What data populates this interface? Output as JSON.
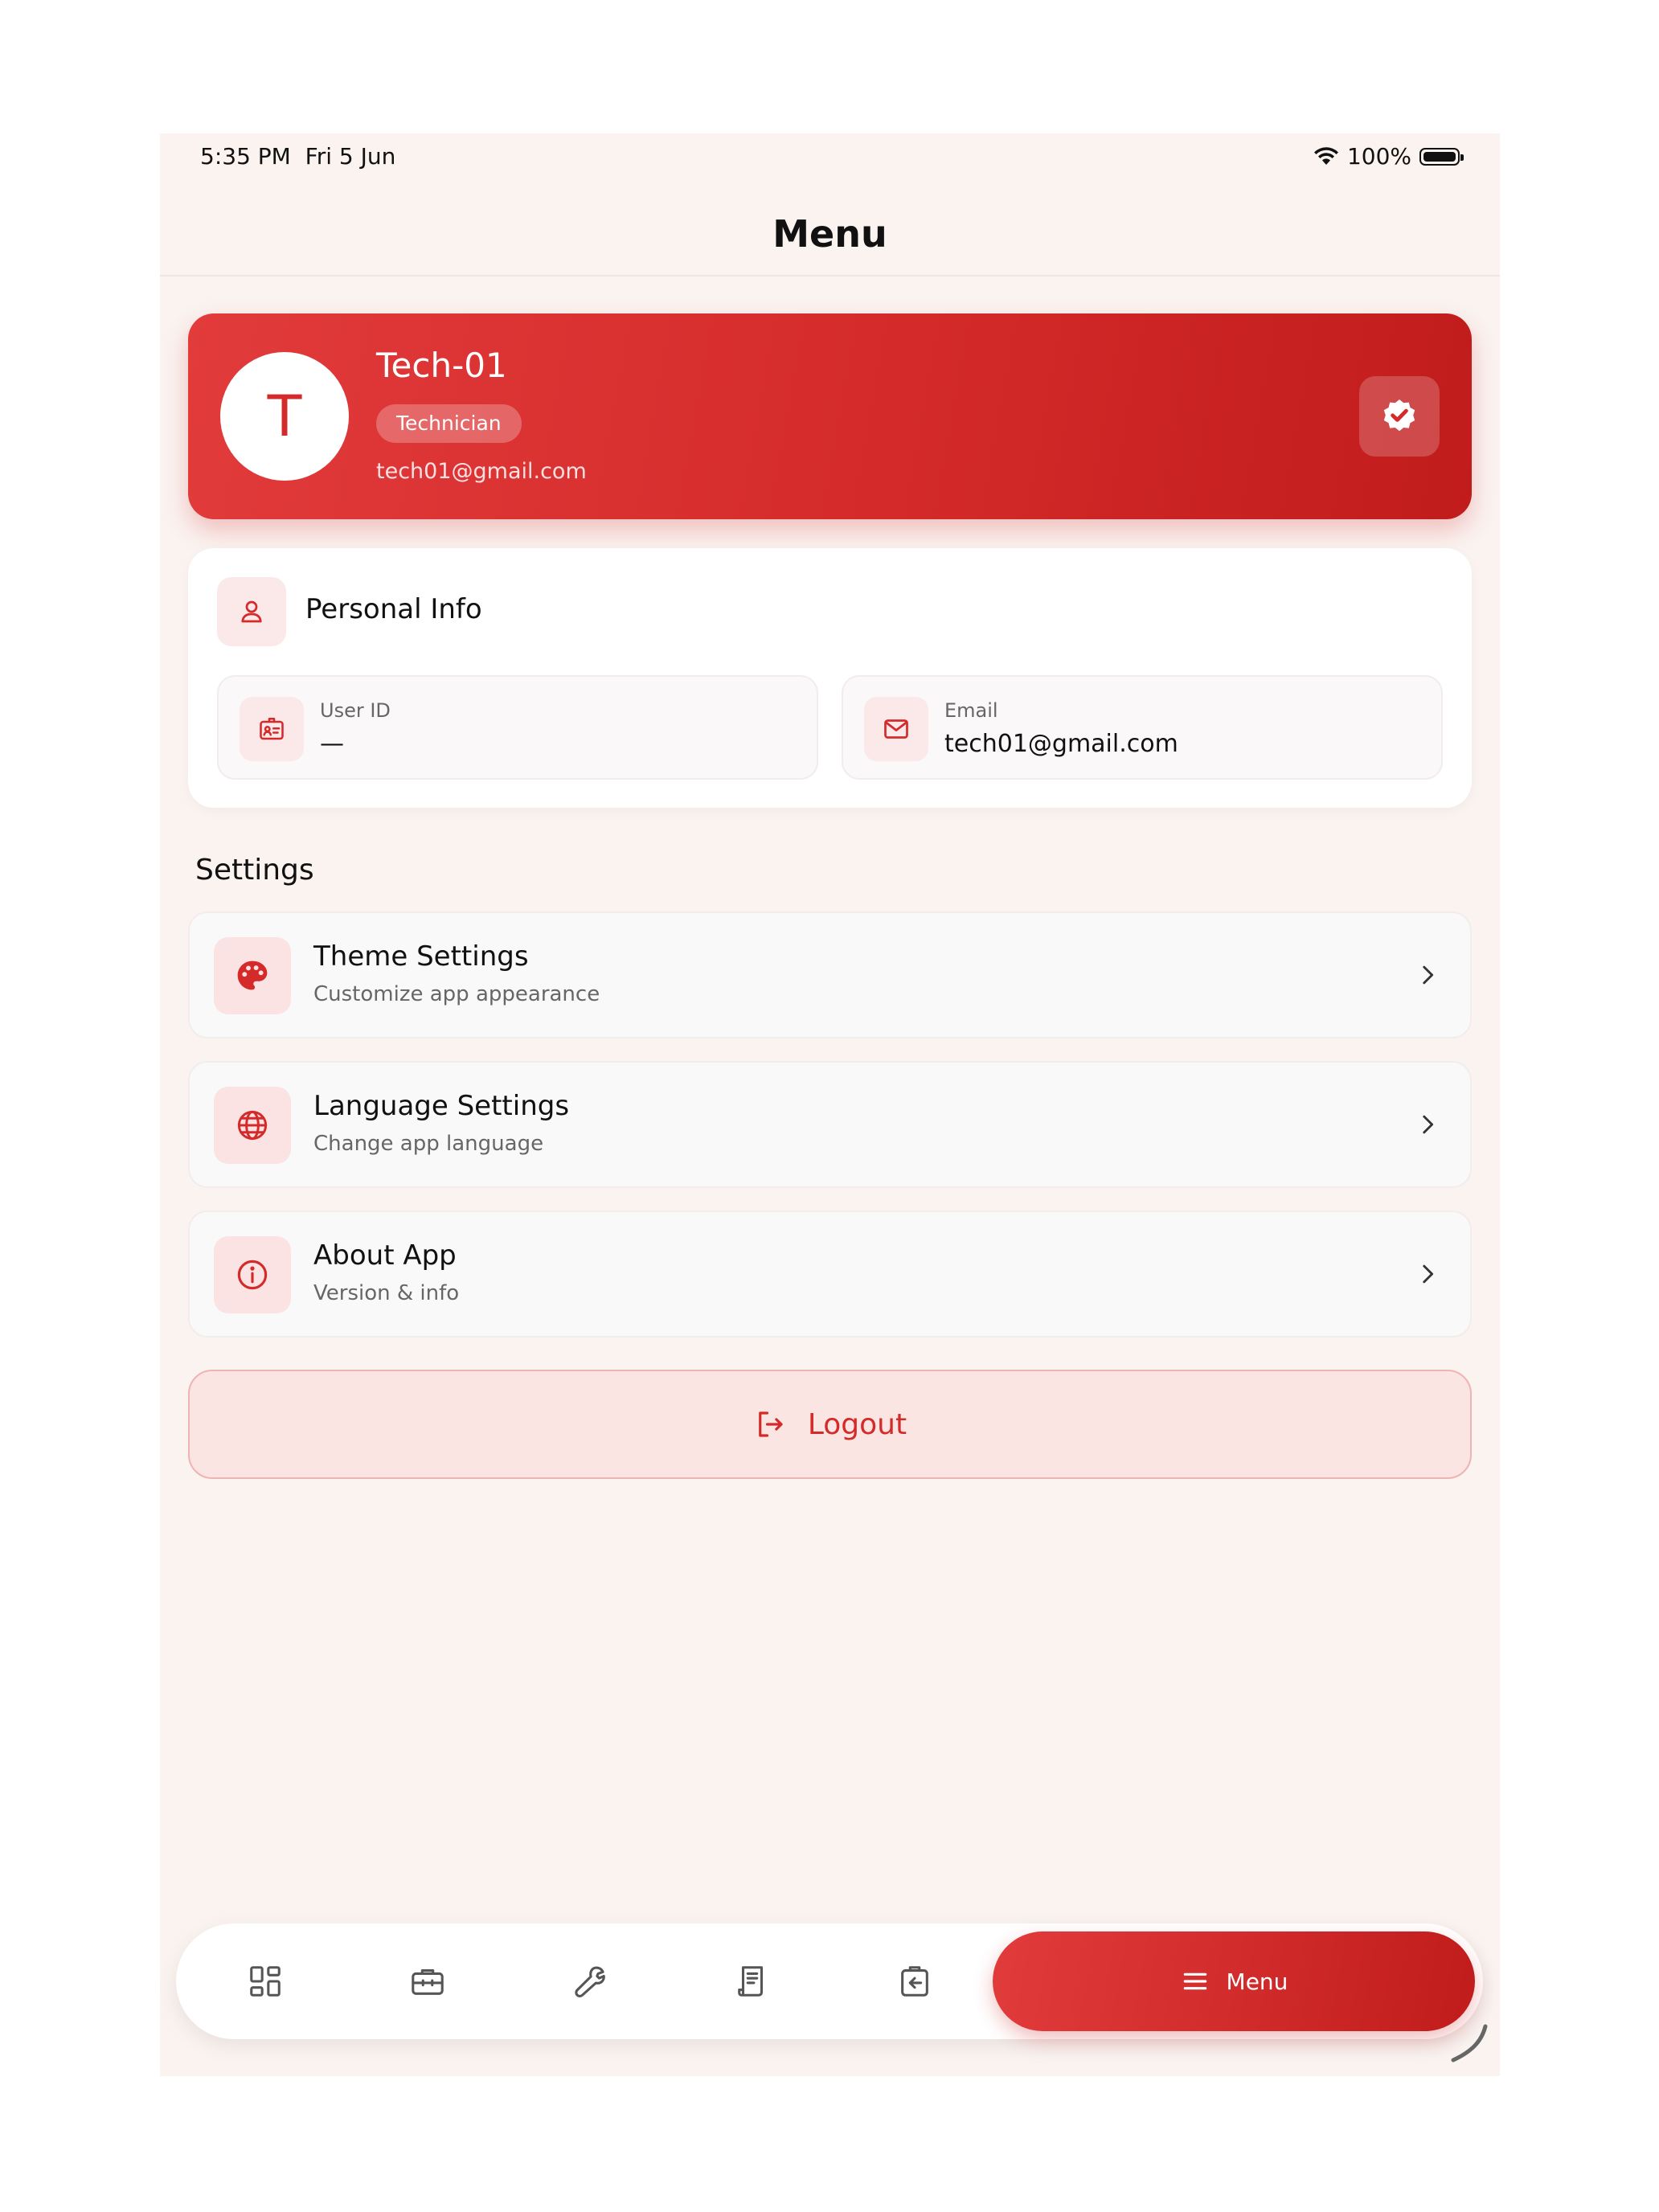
{
  "status_bar": {
    "time": "5:35 PM",
    "date": "Fri 5 Jun",
    "battery": "100%"
  },
  "header": {
    "title": "Menu"
  },
  "profile": {
    "initial": "T",
    "name": "Tech-01",
    "role": "Technician",
    "email": "tech01@gmail.com"
  },
  "personal_info": {
    "title": "Personal Info",
    "fields": [
      {
        "label": "User ID",
        "value": "—"
      },
      {
        "label": "Email",
        "value": "tech01@gmail.com"
      }
    ]
  },
  "settings": {
    "title": "Settings",
    "items": [
      {
        "title": "Theme Settings",
        "subtitle": "Customize app appearance",
        "icon": "palette-icon"
      },
      {
        "title": "Language Settings",
        "subtitle": "Change app language",
        "icon": "globe-icon"
      },
      {
        "title": "About App",
        "subtitle": "Version & info",
        "icon": "info-icon"
      }
    ]
  },
  "logout": {
    "label": "Logout"
  },
  "bottom_nav": {
    "items": [
      "dashboard-icon",
      "briefcase-icon",
      "wrench-icon",
      "receipt-icon",
      "clipboard-icon"
    ],
    "active_label": "Menu"
  },
  "colors": {
    "accent": "#d42a2a",
    "background": "#faf3f0",
    "icon_bg": "#fbe3e3"
  }
}
